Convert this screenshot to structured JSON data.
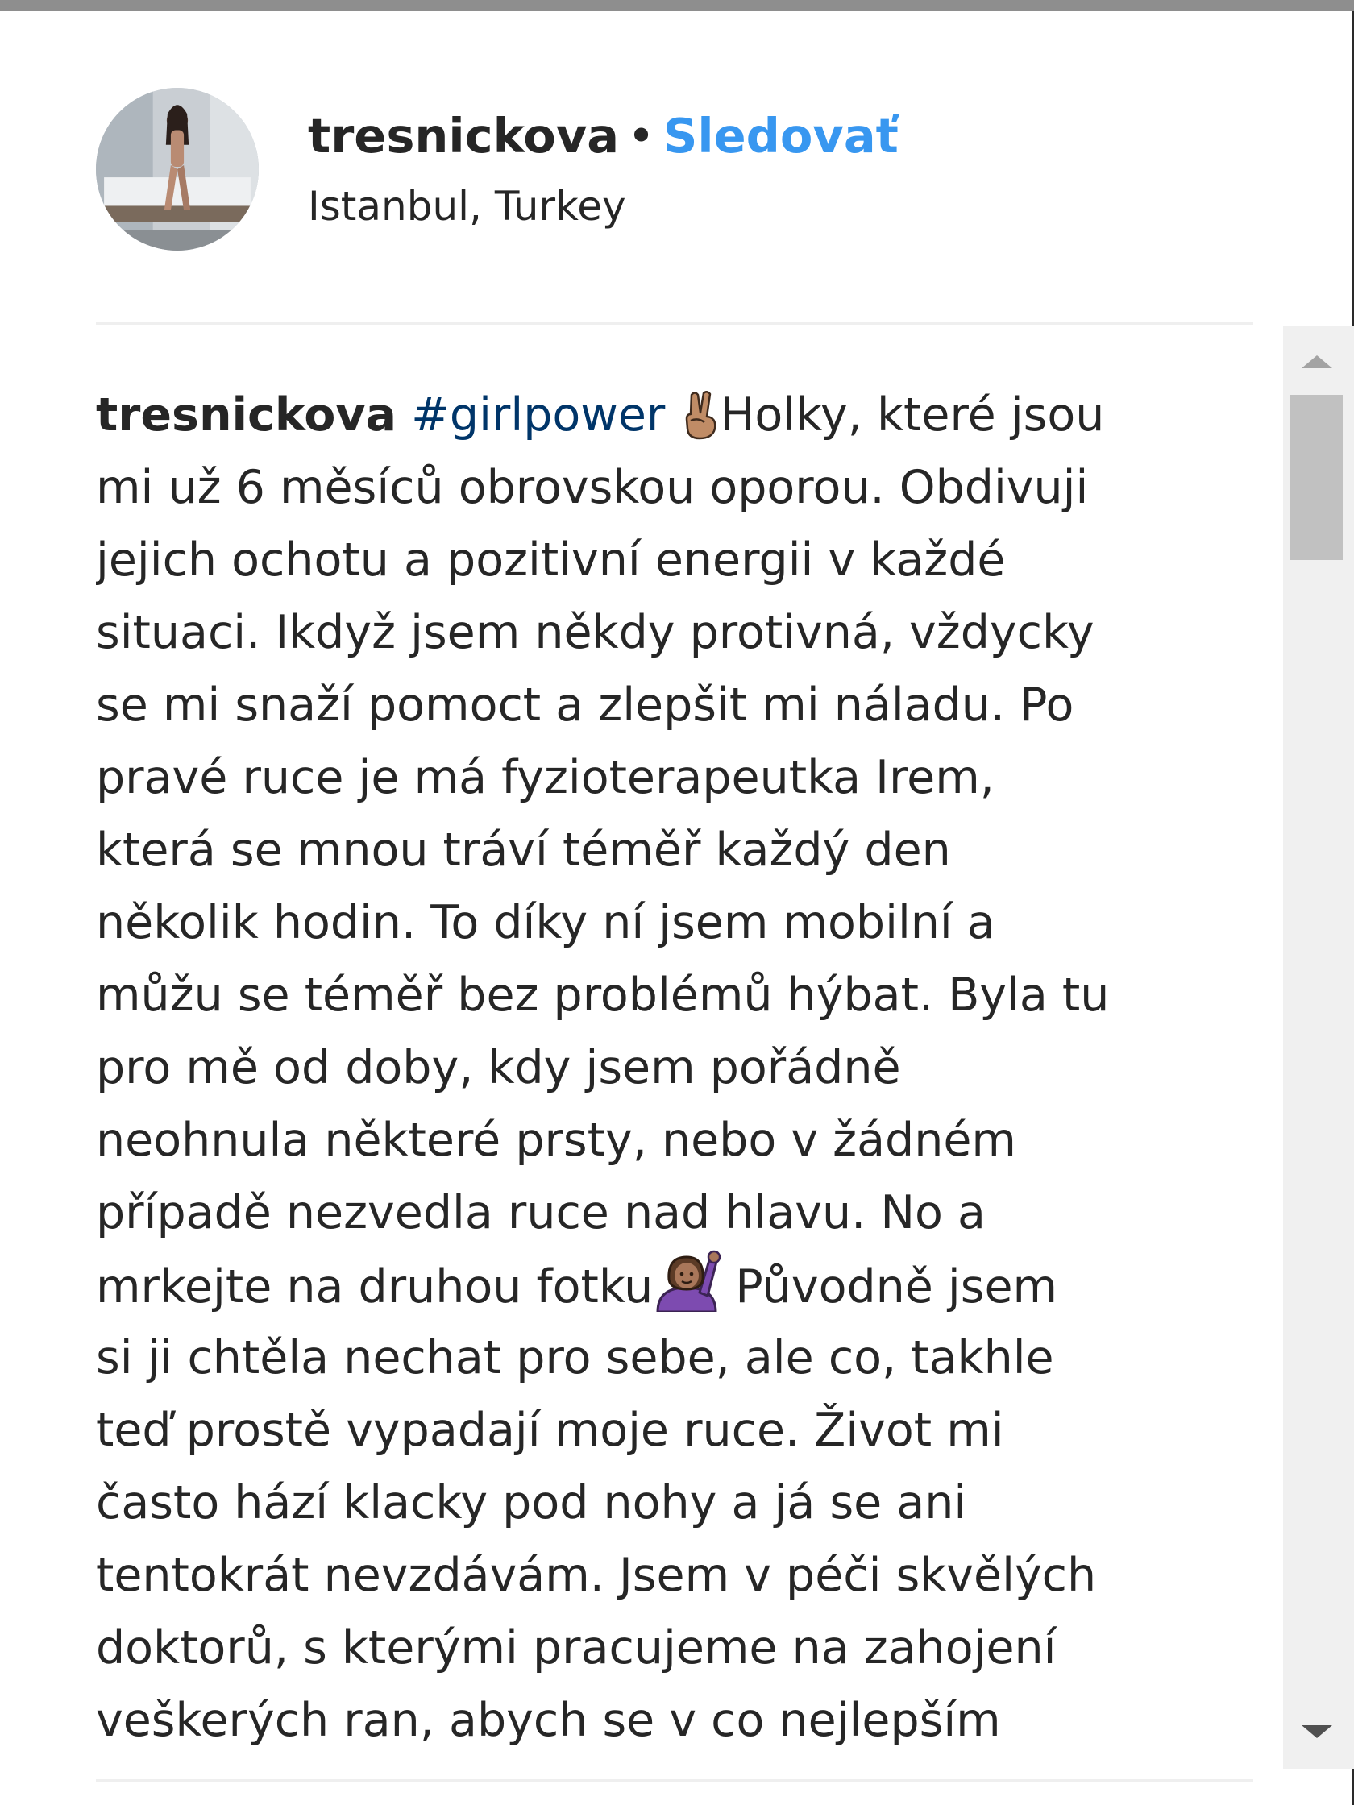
{
  "post": {
    "username": "tresnickova",
    "separator": "•",
    "follow_label": "Sledovať",
    "location": "Istanbul, Turkey"
  },
  "caption": {
    "username": "tresnickova",
    "hashtag": "#girlpower",
    "first_line_text": "Holky, které jsou",
    "line_2": "mi už 6 měsíců obrovskou oporou. Obdivuji",
    "line_3": "jejich ochotu a pozitivní energii v každé",
    "line_4": "situaci. Ikdyž jsem někdy protivná, vždycky",
    "line_5": "se mi snaží pomoct a zlepšit mi náladu. Po",
    "line_6": "pravé ruce je má fyzioterapeutka Irem,",
    "line_7": "která se mnou tráví téměř každý den",
    "line_8": "několik hodin. To díky ní jsem mobilní a",
    "line_9": "můžu se téměř bez problémů hýbat. Byla tu",
    "line_10": "pro mě od doby, kdy jsem pořádně",
    "line_11": "neohnula některé prsty, nebo v žádném",
    "line_12": "případě nezvedla ruce nad hlavu. No a",
    "line_13_before_emoji": "mrkejte na druhou fotku",
    "line_13_after_emoji": " Původně jsem",
    "line_14": "si ji chtěla nechat pro sebe, ale co, takhle",
    "line_15": "teď prostě vypadají moje ruce. Život mi",
    "line_16": "často hází klacky pod nohy a já se ani",
    "line_17": "tentokrát nevzdávám. Jsem v péči skvělých",
    "line_18": "doktorů, s kterými pracujeme na zahojení",
    "line_19": "veškerých ran, abych se v co nejlepším"
  },
  "icons": {
    "emoji_1": "victory-hand-emoji-icon",
    "emoji_2": "person-raising-hand-emoji-icon"
  },
  "colors": {
    "follow": "#3897f0",
    "hashtag": "#003569",
    "text": "#262626"
  }
}
